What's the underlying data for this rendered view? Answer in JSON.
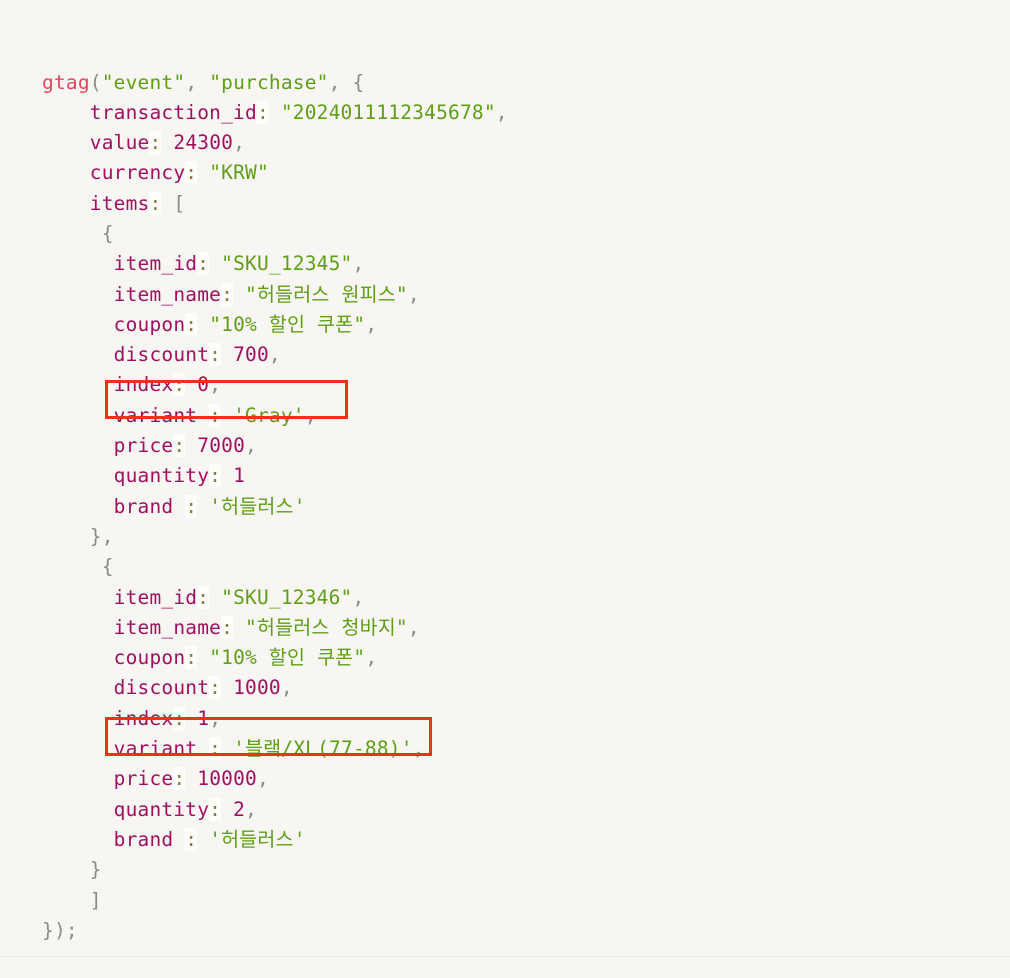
{
  "surface": {
    "background_color": "#f7f6f2",
    "language": "javascript",
    "bottom_rule_color": "#eceae4"
  },
  "theme": {
    "function_color": "#e2475f",
    "key_color": "#a01060",
    "number_color": "#a01060",
    "string_color": "#5f9e17",
    "punctuation_color": "#8a8a88",
    "colon_color": "#8a7d3a",
    "highlight_color": "#ee3217"
  },
  "code": {
    "lines": [
      {
        "indent": "",
        "tokens": [
          {
            "t": "fn",
            "v": "gtag"
          },
          {
            "t": "punct",
            "v": "("
          },
          {
            "t": "str",
            "v": "\"event\""
          },
          {
            "t": "punct",
            "v": ", "
          },
          {
            "t": "str",
            "v": "\"purchase\""
          },
          {
            "t": "punct",
            "v": ", "
          },
          {
            "t": "punct",
            "v": "{"
          }
        ]
      },
      {
        "indent": "    ",
        "tokens": [
          {
            "t": "key",
            "v": "transaction_id"
          },
          {
            "t": "colon",
            "v": ":"
          },
          {
            "t": "plain",
            "v": " "
          },
          {
            "t": "str",
            "v": "\"2024011112345678\""
          },
          {
            "t": "punct",
            "v": ","
          }
        ]
      },
      {
        "indent": "    ",
        "tokens": [
          {
            "t": "key",
            "v": "value"
          },
          {
            "t": "colon",
            "v": ":"
          },
          {
            "t": "plain",
            "v": " "
          },
          {
            "t": "num",
            "v": "24300"
          },
          {
            "t": "punct",
            "v": ","
          }
        ]
      },
      {
        "indent": "    ",
        "tokens": [
          {
            "t": "key",
            "v": "currency"
          },
          {
            "t": "colon",
            "v": ":"
          },
          {
            "t": "plain",
            "v": " "
          },
          {
            "t": "str",
            "v": "\"KRW\""
          }
        ]
      },
      {
        "indent": "    ",
        "tokens": [
          {
            "t": "key",
            "v": "items"
          },
          {
            "t": "colon",
            "v": ":"
          },
          {
            "t": "plain",
            "v": " "
          },
          {
            "t": "punct",
            "v": "["
          }
        ]
      },
      {
        "indent": "     ",
        "tokens": [
          {
            "t": "punct",
            "v": "{"
          }
        ]
      },
      {
        "indent": "      ",
        "tokens": [
          {
            "t": "key",
            "v": "item_id"
          },
          {
            "t": "colon",
            "v": ":"
          },
          {
            "t": "plain",
            "v": " "
          },
          {
            "t": "str",
            "v": "\"SKU_12345\""
          },
          {
            "t": "punct",
            "v": ","
          }
        ]
      },
      {
        "indent": "      ",
        "tokens": [
          {
            "t": "key",
            "v": "item_name"
          },
          {
            "t": "colon",
            "v": ":"
          },
          {
            "t": "plain",
            "v": " "
          },
          {
            "t": "str",
            "v": "\"허들러스 원피스\""
          },
          {
            "t": "punct",
            "v": ","
          }
        ]
      },
      {
        "indent": "      ",
        "tokens": [
          {
            "t": "key",
            "v": "coupon"
          },
          {
            "t": "colon",
            "v": ":"
          },
          {
            "t": "plain",
            "v": " "
          },
          {
            "t": "str",
            "v": "\"10% 할인 쿠폰\""
          },
          {
            "t": "punct",
            "v": ","
          }
        ]
      },
      {
        "indent": "      ",
        "tokens": [
          {
            "t": "key",
            "v": "discount"
          },
          {
            "t": "colon",
            "v": ":"
          },
          {
            "t": "plain",
            "v": " "
          },
          {
            "t": "num",
            "v": "700"
          },
          {
            "t": "punct",
            "v": ","
          }
        ]
      },
      {
        "indent": "      ",
        "tokens": [
          {
            "t": "key",
            "v": "index"
          },
          {
            "t": "colon",
            "v": ":"
          },
          {
            "t": "plain",
            "v": " "
          },
          {
            "t": "num",
            "v": "0"
          },
          {
            "t": "punct",
            "v": ","
          }
        ]
      },
      {
        "indent": "      ",
        "tokens": [
          {
            "t": "key",
            "v": "variant "
          },
          {
            "t": "colon",
            "v": ":"
          },
          {
            "t": "plain",
            "v": " "
          },
          {
            "t": "str",
            "v": "'Gray'"
          },
          {
            "t": "punct",
            "v": ","
          }
        ]
      },
      {
        "indent": "      ",
        "tokens": [
          {
            "t": "key",
            "v": "price"
          },
          {
            "t": "colon",
            "v": ":"
          },
          {
            "t": "plain",
            "v": " "
          },
          {
            "t": "num",
            "v": "7000"
          },
          {
            "t": "punct",
            "v": ","
          }
        ]
      },
      {
        "indent": "      ",
        "tokens": [
          {
            "t": "key",
            "v": "quantity"
          },
          {
            "t": "colon",
            "v": ":"
          },
          {
            "t": "plain",
            "v": " "
          },
          {
            "t": "num",
            "v": "1"
          }
        ]
      },
      {
        "indent": "      ",
        "tokens": [
          {
            "t": "key",
            "v": "brand "
          },
          {
            "t": "colon",
            "v": ":"
          },
          {
            "t": "plain",
            "v": " "
          },
          {
            "t": "str",
            "v": "'허들러스'"
          }
        ]
      },
      {
        "indent": "    ",
        "tokens": [
          {
            "t": "punct",
            "v": "},"
          }
        ]
      },
      {
        "indent": "     ",
        "tokens": [
          {
            "t": "punct",
            "v": "{"
          }
        ]
      },
      {
        "indent": "      ",
        "tokens": [
          {
            "t": "key",
            "v": "item_id"
          },
          {
            "t": "colon",
            "v": ":"
          },
          {
            "t": "plain",
            "v": " "
          },
          {
            "t": "str",
            "v": "\"SKU_12346\""
          },
          {
            "t": "punct",
            "v": ","
          }
        ]
      },
      {
        "indent": "      ",
        "tokens": [
          {
            "t": "key",
            "v": "item_name"
          },
          {
            "t": "colon",
            "v": ":"
          },
          {
            "t": "plain",
            "v": " "
          },
          {
            "t": "str",
            "v": "\"허들러스 청바지\""
          },
          {
            "t": "punct",
            "v": ","
          }
        ]
      },
      {
        "indent": "      ",
        "tokens": [
          {
            "t": "key",
            "v": "coupon"
          },
          {
            "t": "colon",
            "v": ":"
          },
          {
            "t": "plain",
            "v": " "
          },
          {
            "t": "str",
            "v": "\"10% 할인 쿠폰\""
          },
          {
            "t": "punct",
            "v": ","
          }
        ]
      },
      {
        "indent": "      ",
        "tokens": [
          {
            "t": "key",
            "v": "discount"
          },
          {
            "t": "colon",
            "v": ":"
          },
          {
            "t": "plain",
            "v": " "
          },
          {
            "t": "num",
            "v": "1000"
          },
          {
            "t": "punct",
            "v": ","
          }
        ]
      },
      {
        "indent": "      ",
        "tokens": [
          {
            "t": "key",
            "v": "index"
          },
          {
            "t": "colon",
            "v": ":"
          },
          {
            "t": "plain",
            "v": " "
          },
          {
            "t": "num",
            "v": "1"
          },
          {
            "t": "punct",
            "v": ","
          }
        ]
      },
      {
        "indent": "      ",
        "tokens": [
          {
            "t": "key",
            "v": "variant "
          },
          {
            "t": "colon",
            "v": ":"
          },
          {
            "t": "plain",
            "v": " "
          },
          {
            "t": "str",
            "v": "'블랙/XL(77-88)'"
          },
          {
            "t": "punct",
            "v": ","
          }
        ]
      },
      {
        "indent": "      ",
        "tokens": [
          {
            "t": "key",
            "v": "price"
          },
          {
            "t": "colon",
            "v": ":"
          },
          {
            "t": "plain",
            "v": " "
          },
          {
            "t": "num",
            "v": "10000"
          },
          {
            "t": "punct",
            "v": ","
          }
        ]
      },
      {
        "indent": "      ",
        "tokens": [
          {
            "t": "key",
            "v": "quantity"
          },
          {
            "t": "colon",
            "v": ":"
          },
          {
            "t": "plain",
            "v": " "
          },
          {
            "t": "num",
            "v": "2"
          },
          {
            "t": "punct",
            "v": ","
          }
        ]
      },
      {
        "indent": "      ",
        "tokens": [
          {
            "t": "key",
            "v": "brand "
          },
          {
            "t": "colon",
            "v": ":"
          },
          {
            "t": "plain",
            "v": " "
          },
          {
            "t": "str",
            "v": "'허들러스'"
          }
        ]
      },
      {
        "indent": "    ",
        "tokens": [
          {
            "t": "punct",
            "v": "}"
          }
        ]
      },
      {
        "indent": "    ",
        "tokens": [
          {
            "t": "punct",
            "v": "]"
          }
        ]
      },
      {
        "indent": "",
        "tokens": [
          {
            "t": "punct",
            "v": "});"
          }
        ]
      }
    ]
  },
  "annotations": [
    {
      "id": "variant-box-1",
      "shape": "rectangle",
      "color": "#ee3217",
      "target_line_index": 11,
      "target_text": "variant : 'Gray',"
    },
    {
      "id": "variant-box-2",
      "shape": "rectangle",
      "color": "#ee3217",
      "target_line_index": 22,
      "target_text": "variant : '블랙/XL(77-88)',"
    }
  ]
}
